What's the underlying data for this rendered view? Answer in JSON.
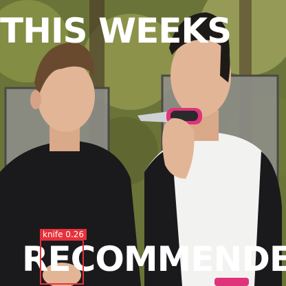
{
  "caption": {
    "top": "THIS WEEKS",
    "bottom": "RECOMMENDED"
  },
  "detection": {
    "label": "knife 0.26",
    "color": "#e8303a"
  },
  "colors": {
    "foliage": "#7f8a44",
    "skin": "#e2b596",
    "shirt_black": "#1a1a1c",
    "shirt_white": "#f2f2f0",
    "knife_handle": "#e0337a",
    "chair": "#8e8e88"
  }
}
